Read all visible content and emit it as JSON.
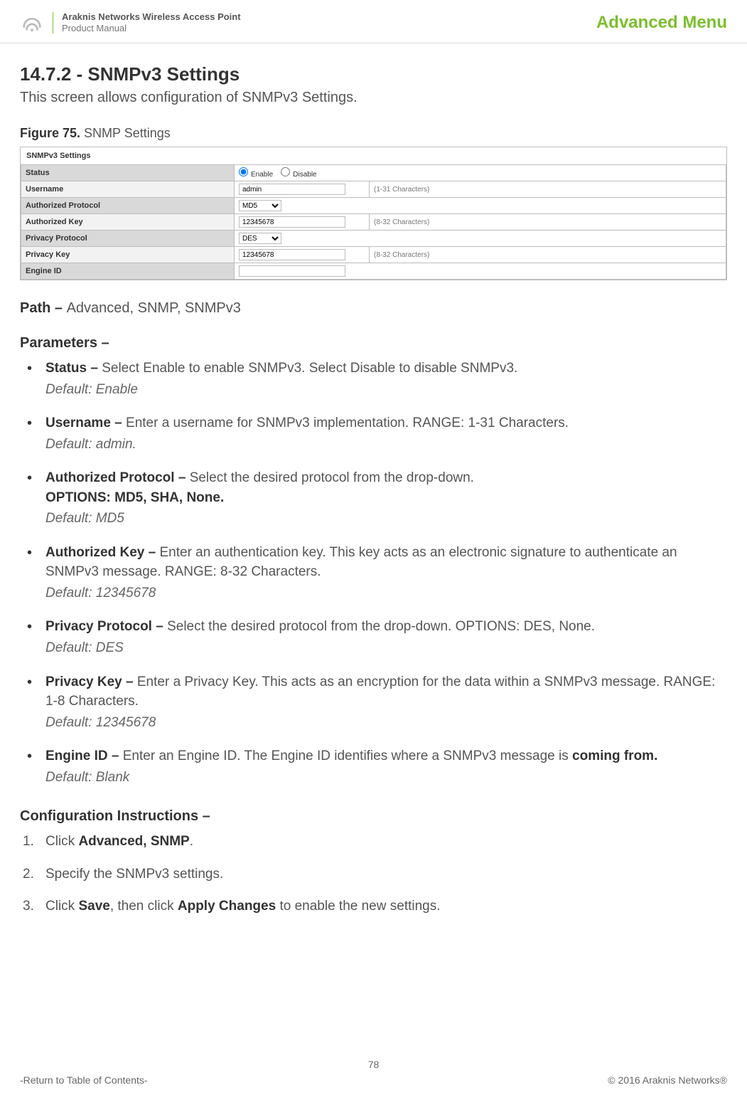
{
  "header": {
    "title": "Araknis Networks Wireless Access Point",
    "subtitle": "Product Manual",
    "advanced_menu": "Advanced Menu"
  },
  "section": {
    "number_title": "14.7.2 - SNMPv3 Settings",
    "intro": "This screen allows configuration of SNMPv3 Settings."
  },
  "figure": {
    "label_bold": "Figure 75.",
    "label_rest": " SNMP Settings"
  },
  "screenshot": {
    "caption": "SNMPv3 Settings",
    "rows": {
      "status": {
        "label": "Status",
        "enable": "Enable",
        "disable": "Disable"
      },
      "username": {
        "label": "Username",
        "value": "admin",
        "hint": "(1-31 Characters)"
      },
      "auth_protocol": {
        "label": "Authorized Protocol",
        "value": "MD5"
      },
      "auth_key": {
        "label": "Authorized Key",
        "value": "12345678",
        "hint": "(8-32 Characters)"
      },
      "priv_protocol": {
        "label": "Privacy Protocol",
        "value": "DES"
      },
      "priv_key": {
        "label": "Privacy Key",
        "value": "12345678",
        "hint": "(8-32 Characters)"
      },
      "engine_id": {
        "label": "Engine ID",
        "value": ""
      }
    }
  },
  "path": {
    "bold": "Path – ",
    "rest": "Advanced, SNMP, SNMPv3"
  },
  "parameters_heading": "Parameters –",
  "params": [
    {
      "term": "Status – ",
      "desc": "Select Enable to enable SNMPv3. Select Disable to disable SNMPv3.",
      "opt": "",
      "def": "Default: Enable"
    },
    {
      "term": "Username – ",
      "desc": "Enter a username for SNMPv3 implementation. RANGE: 1-31 Characters.",
      "opt": "",
      "def": "Default: admin."
    },
    {
      "term": "Authorized Protocol – ",
      "desc": "Select the desired protocol from the drop-down.",
      "opt": "OPTIONS: MD5, SHA, None.",
      "def": "Default: MD5"
    },
    {
      "term": "Authorized Key – ",
      "desc": "Enter an authentication key. This key acts as an electronic signature to authenticate an SNMPv3 message. RANGE: 8-32 Characters.",
      "opt": "",
      "def": "Default: 12345678"
    },
    {
      "term": "Privacy Protocol – ",
      "desc": "Select the desired protocol from the drop-down. OPTIONS: DES, None.",
      "opt": "",
      "def": "Default: DES"
    },
    {
      "term": "Privacy Key – ",
      "desc": "Enter a Privacy Key. This acts as an encryption for the data within a SNMPv3 message. RANGE: 1-8 Characters.",
      "opt": "",
      "def": "Default: 12345678"
    },
    {
      "term": "Engine ID – ",
      "desc": "Enter an Engine ID. The Engine ID identifies where a SNMPv3 message is ",
      "opt": "coming from.",
      "def": "Default: Blank"
    }
  ],
  "config_heading": "Configuration Instructions –",
  "steps": [
    {
      "pre": "Click ",
      "b1": "Advanced, SNMP",
      "mid": ".",
      "b2": "",
      "post": ""
    },
    {
      "pre": "Specify the SNMPv3 settings.",
      "b1": "",
      "mid": "",
      "b2": "",
      "post": ""
    },
    {
      "pre": "Click ",
      "b1": "Save",
      "mid": ", then click ",
      "b2": "Apply Changes",
      "post": " to enable the new settings."
    }
  ],
  "footer": {
    "page": "78",
    "left": "-Return to Table of Contents-",
    "right": "© 2016 Araknis Networks®"
  }
}
